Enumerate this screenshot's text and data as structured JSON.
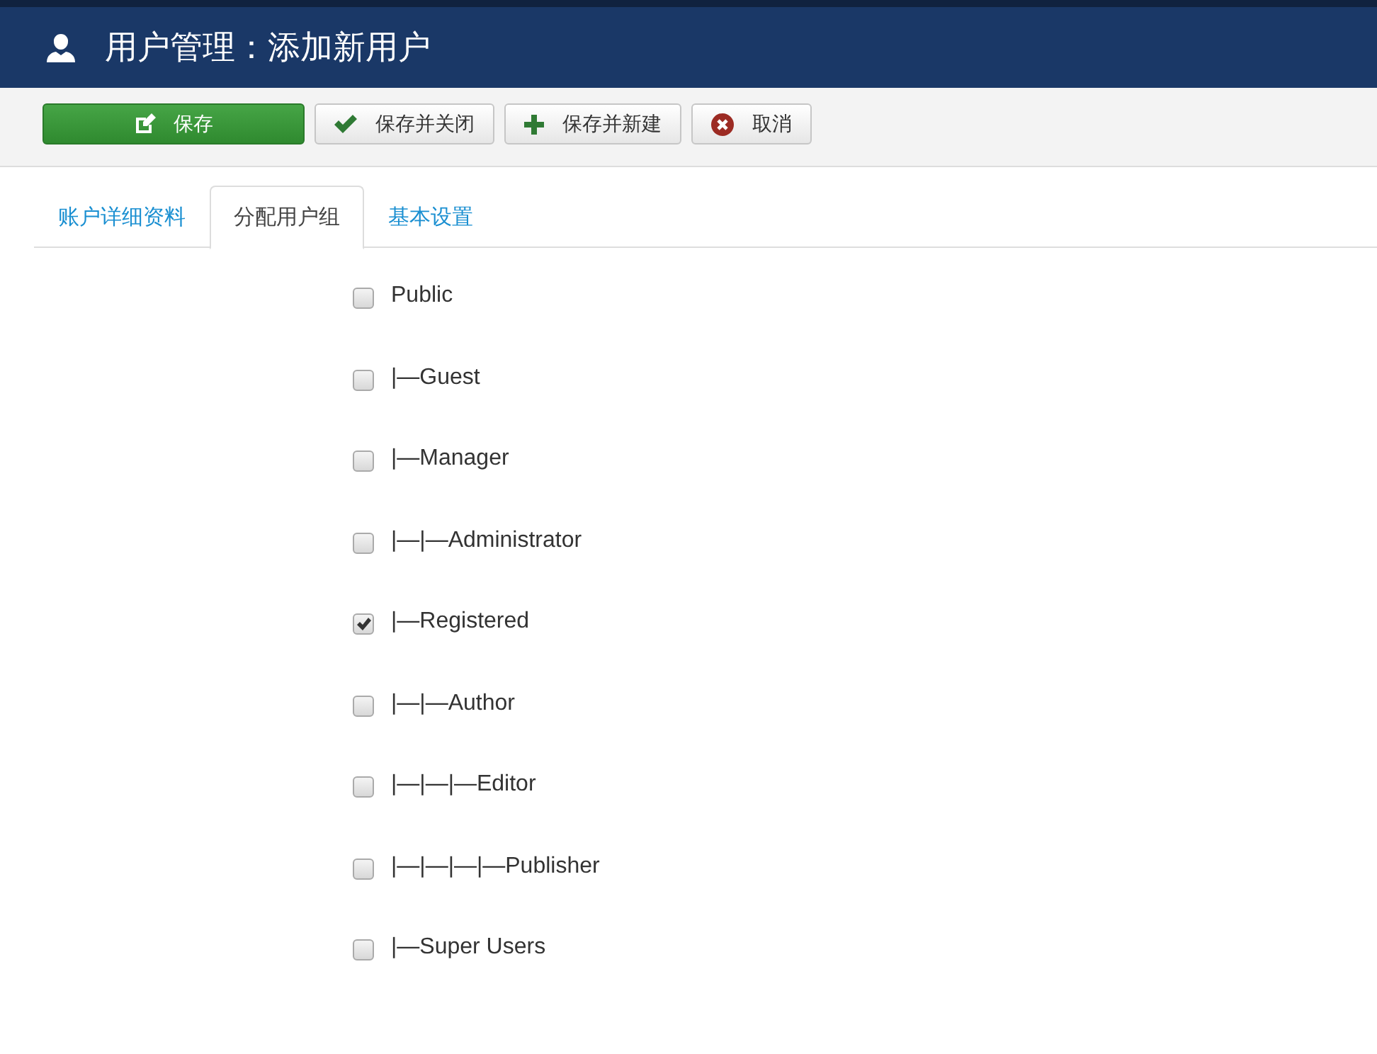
{
  "header": {
    "title": "用户管理：添加新用户"
  },
  "toolbar": [
    {
      "kind": "save",
      "label": "保存"
    },
    {
      "kind": "save-close",
      "label": "保存并关闭"
    },
    {
      "kind": "save-new",
      "label": "保存并新建"
    },
    {
      "kind": "cancel",
      "label": "取消"
    }
  ],
  "tabs": [
    {
      "label": "账户详细资料",
      "selected": false
    },
    {
      "label": "分配用户组",
      "selected": true
    },
    {
      "label": "基本设置",
      "selected": false
    }
  ],
  "groups": [
    {
      "label": "Public",
      "checked": false,
      "children": [
        {
          "label": "|—Guest",
          "checked": false
        },
        {
          "label": "|—Manager",
          "checked": false,
          "children": [
            {
              "label": "|—|—Administrator",
              "checked": false
            }
          ]
        },
        {
          "label": "|—Registered",
          "checked": true,
          "children": [
            {
              "label": "|—|—Author",
              "checked": false,
              "children": [
                {
                  "label": "|—|—|—Editor",
                  "checked": false,
                  "children": [
                    {
                      "label": "|—|—|—|—Publisher",
                      "checked": false
                    }
                  ]
                }
              ]
            }
          ]
        },
        {
          "label": "|—Super Users",
          "checked": false
        }
      ]
    }
  ]
}
